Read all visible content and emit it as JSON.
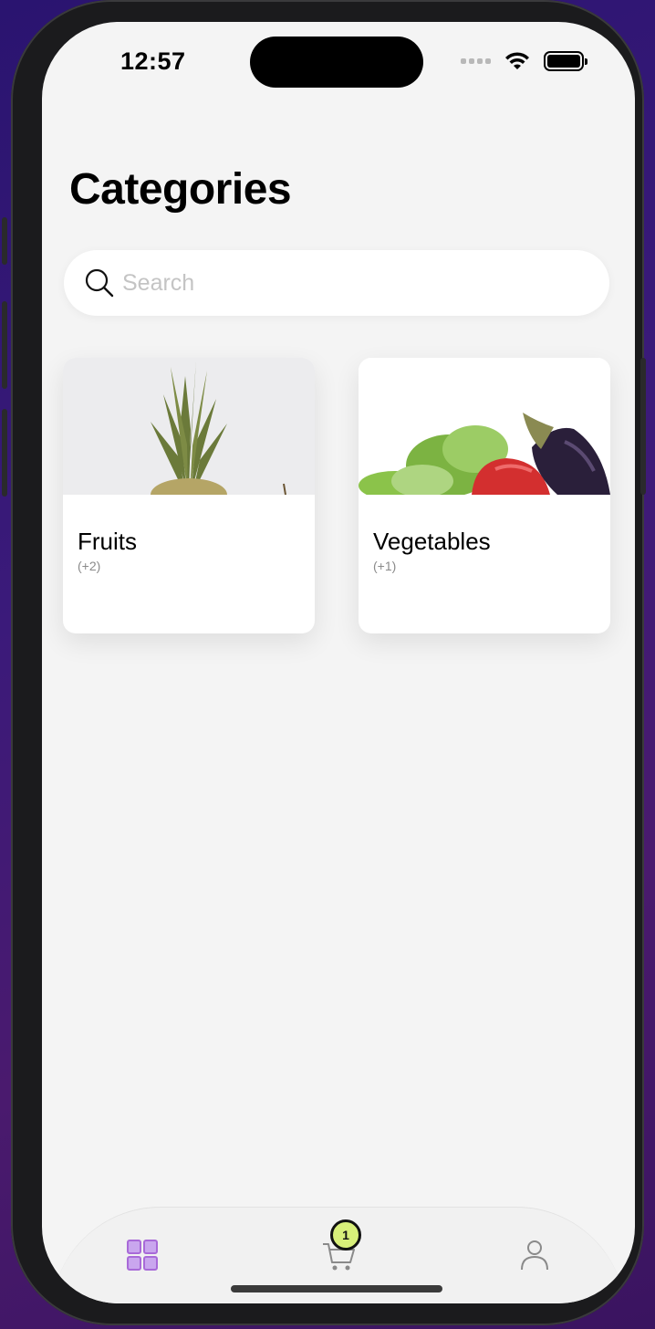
{
  "status": {
    "time": "12:57"
  },
  "page": {
    "title": "Categories"
  },
  "search": {
    "placeholder": "Search"
  },
  "categories": [
    {
      "name": "Fruits",
      "count": "(+2)"
    },
    {
      "name": "Vegetables",
      "count": "(+1)"
    }
  ],
  "tabbar": {
    "cart_badge": "1",
    "active_tab": "categories",
    "accent": "#a86ad8",
    "badge_color": "#d8ef7a"
  },
  "icons": [
    "wifi-icon",
    "battery-icon",
    "search-icon",
    "grid-icon",
    "cart-icon",
    "profile-icon"
  ]
}
